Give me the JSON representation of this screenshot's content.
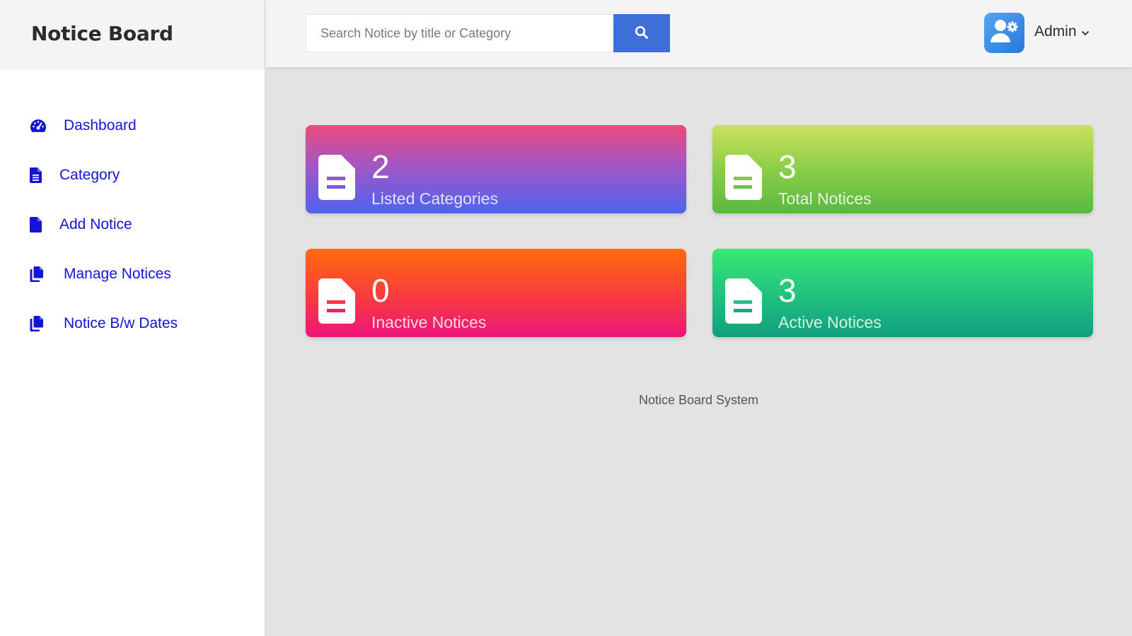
{
  "brand": {
    "title": "Notice Board"
  },
  "sidebar": {
    "items": [
      {
        "label": "Dashboard",
        "icon": "dashboard-gauge-icon"
      },
      {
        "label": "Category",
        "icon": "file-text-icon"
      },
      {
        "label": "Add Notice",
        "icon": "file-icon"
      },
      {
        "label": "Manage Notices",
        "icon": "copy-files-icon"
      },
      {
        "label": "Notice B/w Dates",
        "icon": "copy-files-icon"
      }
    ],
    "link_color": "#1414d4"
  },
  "header": {
    "search": {
      "placeholder": "Search Notice by title or Category",
      "value": "",
      "button_icon": "search-icon"
    },
    "user": {
      "name": "Admin",
      "avatar_icon": "user-gear-icon"
    }
  },
  "stats": [
    {
      "value": "2",
      "label": "Listed Categories",
      "icon": "file-text-icon"
    },
    {
      "value": "3",
      "label": "Total Notices",
      "icon": "file-text-icon"
    },
    {
      "value": "0",
      "label": "Inactive Notices",
      "icon": "file-text-icon"
    },
    {
      "value": "3",
      "label": "Active Notices",
      "icon": "file-text-icon"
    }
  ],
  "footer": {
    "text": "Notice Board System"
  },
  "colors": {
    "accent_blue": "#3e6fd8",
    "card_1": [
      "#ec4b7c",
      "#4e63f2"
    ],
    "card_2": [
      "#cde05a",
      "#5ab743"
    ],
    "card_3": [
      "#ff6b0d",
      "#ec1578"
    ],
    "card_4": [
      "#3ae876",
      "#129e7e"
    ]
  }
}
